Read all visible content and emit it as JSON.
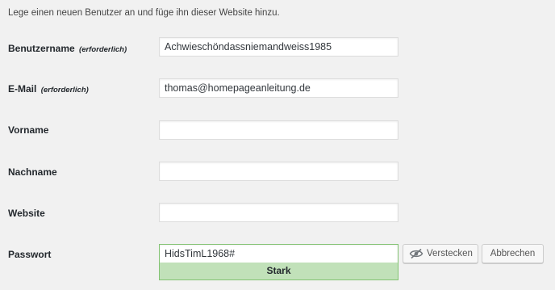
{
  "intro": "Lege einen neuen Benutzer an und füge ihn dieser Website hinzu.",
  "form": {
    "username": {
      "label": "Benutzername",
      "required_note": "(erforderlich)",
      "value": "Achwieschöndassniemandweiss1985"
    },
    "email": {
      "label": "E-Mail",
      "required_note": "(erforderlich)",
      "value": "thomas@homepageanleitung.de"
    },
    "first_name": {
      "label": "Vorname",
      "value": ""
    },
    "last_name": {
      "label": "Nachname",
      "value": ""
    },
    "website": {
      "label": "Website",
      "value": ""
    },
    "password": {
      "label": "Passwort",
      "value": "HidsTimL1968#",
      "strength_label": "Stark",
      "hide_button": "Verstecken",
      "cancel_button": "Abbrechen",
      "hide_icon": "eye-slash-icon"
    }
  },
  "colors": {
    "strength_background": "#c1e1b9",
    "strength_border": "#83c373",
    "page_background": "#f1f1f1"
  }
}
